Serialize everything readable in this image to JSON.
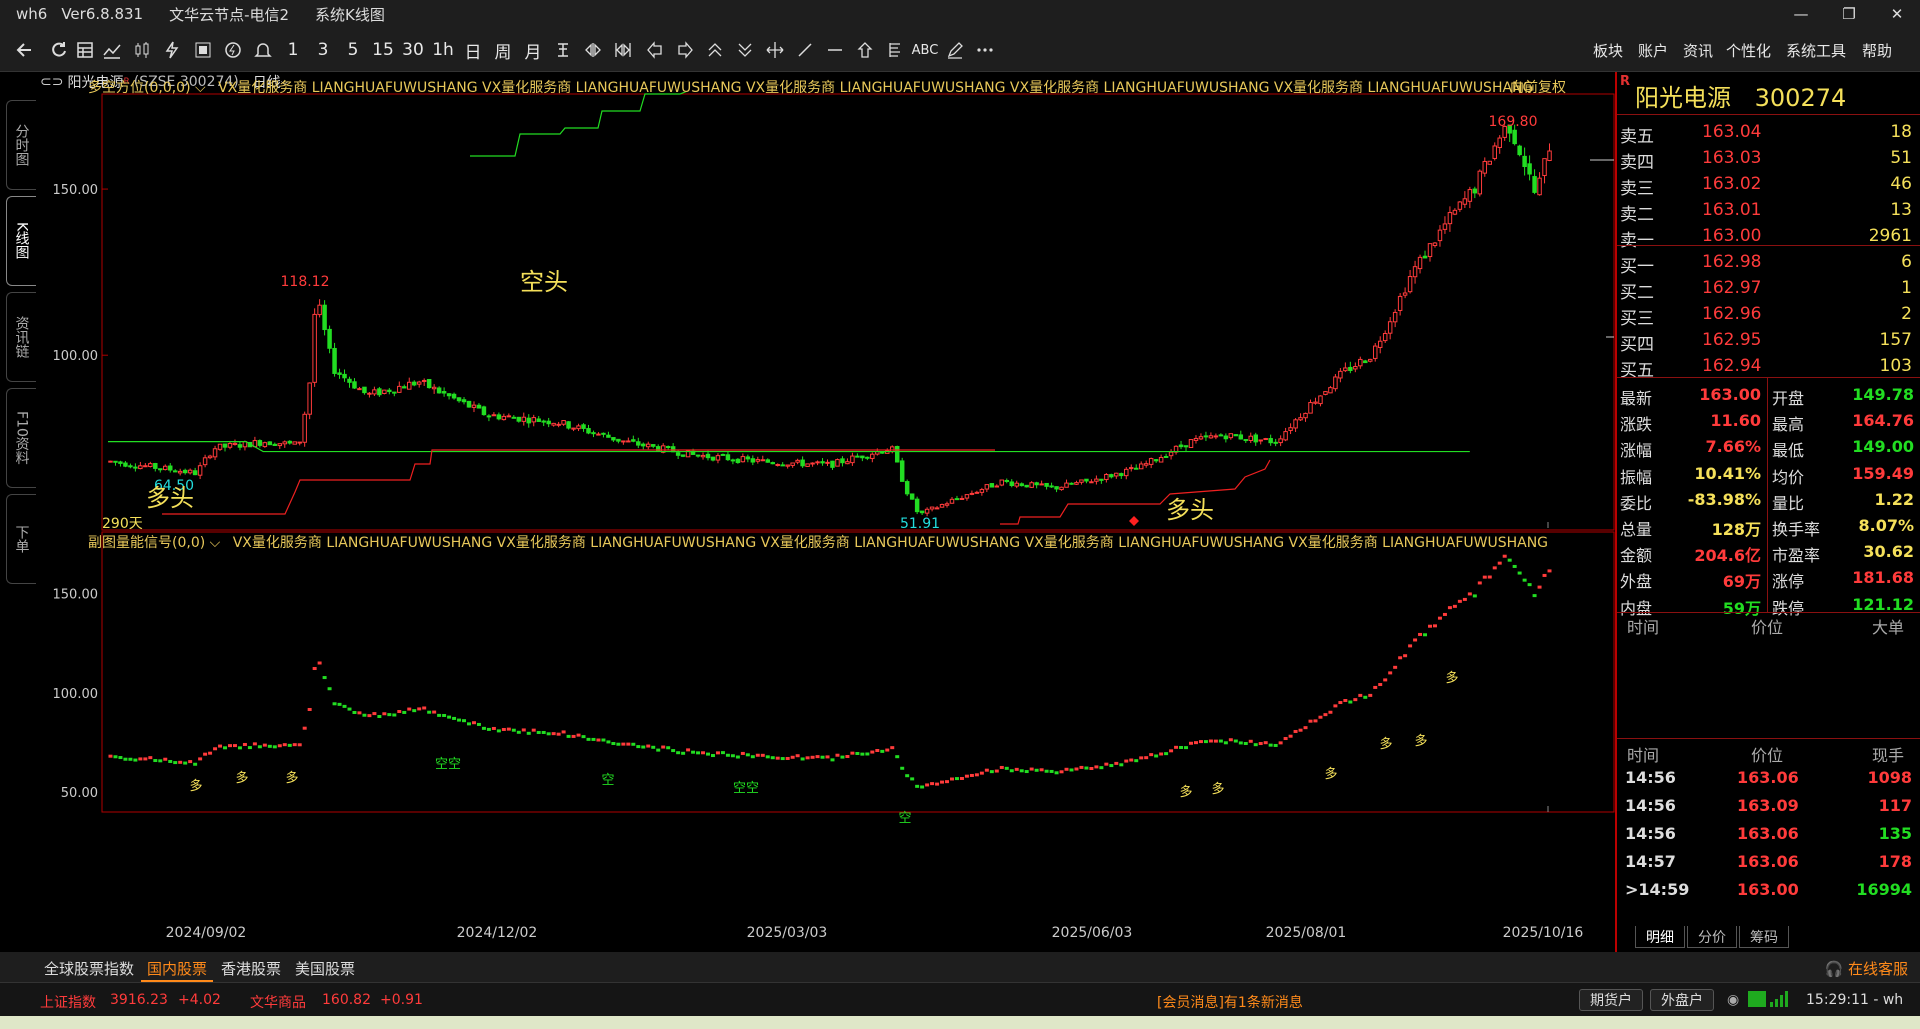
{
  "window": {
    "app": "wh6",
    "version": "Ver6.8.831",
    "server": "文华云节点-电信2",
    "view": "系统K线图",
    "controls": [
      "—",
      "❐",
      "✕"
    ]
  },
  "toolbar": {
    "period_buttons": [
      "1",
      "3",
      "5",
      "15",
      "30",
      "1h",
      "日",
      "周",
      "月"
    ],
    "menus": [
      "板块",
      "账户",
      "资讯",
      "个性化",
      "系统工具",
      "帮助"
    ],
    "text_tools": [
      "ABC"
    ]
  },
  "left_tabs": [
    {
      "label": "分时图"
    },
    {
      "label": "K线图"
    },
    {
      "label": "资讯链"
    },
    {
      "label": "F10资料"
    },
    {
      "label": "下单"
    }
  ],
  "stock_title": {
    "name": "阳光电源",
    "sup": "R",
    "code": "(SZSE 300274)",
    "period": "日线"
  },
  "main_panel": {
    "indicator_name": "多空方位(0,0,0)",
    "indicator_text": "VX量化服务商  LIANGHUAFUWUSHANG  VX量化服务商  LIANGHUAFUWUSHANG  VX量化服务商  LIANGHUAFUWUSHANG  VX量化服务商  LIANGHUAFUWUSHANG  VX量化服务商  LIANGHUAFUWUSHANG",
    "adjust_label": "向前复权",
    "days_label": "290天",
    "annotations": {
      "kong_tou": "空头",
      "duo_tou_1": "多头",
      "duo_tou_2": "多头",
      "high_label": "169.80",
      "local_high_label": "118.12",
      "low_label": "64.50",
      "min_label": "51.91"
    }
  },
  "sub_panel": {
    "indicator_name": "副图量能信号(0,0)",
    "indicator_text": "VX量化服务商  LIANGHUAFUWUSHANG  VX量化服务商  LIANGHUAFUWUSHANG  VX量化服务商  LIANGHUAFUWUSHANG  VX量化服务商  LIANGHUAFUWUSHANG  VX量化服务商  LIANGHUAFUWUSHANG",
    "marks": [
      "多",
      "多",
      "多",
      "空空",
      "空",
      "空空",
      "空",
      "多",
      "多",
      "多",
      "多",
      "多",
      "多"
    ]
  },
  "chart_data": {
    "type": "candlestick",
    "main_y_ticks": [
      "150.00",
      "100.00"
    ],
    "sub_y_ticks": [
      "150.00",
      "100.00",
      "50.00"
    ],
    "x_ticks": [
      "2024/09/02",
      "2024/12/02",
      "2025/03/03",
      "2025/06/03",
      "2025/08/01",
      "2025/10/16"
    ],
    "main_ylim": [
      48,
      175
    ],
    "sub_ylim": [
      40,
      175
    ],
    "n_bars": 290,
    "price_path_anchors": [
      [
        0,
        68
      ],
      [
        15,
        66
      ],
      [
        25,
        64.5
      ],
      [
        30,
        72
      ],
      [
        45,
        74
      ],
      [
        55,
        73
      ],
      [
        58,
        90
      ],
      [
        60,
        118.12
      ],
      [
        65,
        96
      ],
      [
        75,
        88
      ],
      [
        90,
        92
      ],
      [
        110,
        82
      ],
      [
        130,
        80
      ],
      [
        150,
        74
      ],
      [
        170,
        70
      ],
      [
        190,
        68
      ],
      [
        210,
        67
      ],
      [
        220,
        70
      ],
      [
        228,
        72
      ],
      [
        232,
        60
      ],
      [
        236,
        51.91
      ],
      [
        245,
        56
      ],
      [
        260,
        62
      ],
      [
        275,
        60
      ],
      [
        285,
        62
      ],
      [
        300,
        66
      ],
      [
        315,
        74
      ],
      [
        325,
        76
      ],
      [
        340,
        74
      ],
      [
        350,
        85
      ],
      [
        360,
        95
      ],
      [
        368,
        100
      ],
      [
        373,
        110
      ],
      [
        380,
        125
      ],
      [
        390,
        140
      ],
      [
        398,
        150
      ],
      [
        405,
        165
      ],
      [
        408,
        169.8
      ],
      [
        412,
        160
      ],
      [
        416,
        148
      ],
      [
        420,
        163
      ]
    ],
    "bars_per_anchor_unit": 0.69,
    "resistance_line": [
      [
        0,
        74
      ],
      [
        40,
        74
      ],
      [
        45,
        71
      ],
      [
        395,
        71
      ]
    ],
    "kong_line_points": [
      [
        470,
        142
      ],
      [
        515,
        142
      ],
      [
        520,
        120
      ],
      [
        560,
        120
      ],
      [
        565,
        114
      ],
      [
        598,
        114
      ],
      [
        602,
        97
      ],
      [
        640,
        97
      ],
      [
        645,
        80
      ],
      [
        680,
        80
      ],
      [
        690,
        76
      ],
      [
        812,
        76
      ],
      [
        818,
        70
      ],
      [
        995,
        70
      ]
    ],
    "duo_line_points": [
      [
        162,
        500
      ],
      [
        285,
        500
      ],
      [
        295,
        478
      ],
      [
        300,
        466
      ],
      [
        410,
        466
      ],
      [
        415,
        450
      ],
      [
        430,
        450
      ],
      [
        432,
        436
      ],
      [
        470,
        436
      ],
      [
        995,
        436
      ]
    ],
    "duo_line_points_2": [
      [
        1000,
        510
      ],
      [
        1018,
        510
      ],
      [
        1020,
        503
      ],
      [
        1060,
        503
      ],
      [
        1068,
        490
      ],
      [
        1160,
        490
      ],
      [
        1170,
        480
      ],
      [
        1235,
        475
      ],
      [
        1245,
        463
      ],
      [
        1265,
        455
      ],
      [
        1270,
        446
      ]
    ]
  },
  "quote": {
    "flag": "R",
    "name": "阳光电源",
    "code": "300274",
    "asks": [
      {
        "label": "卖五",
        "price": "163.04",
        "vol": "18"
      },
      {
        "label": "卖四",
        "price": "163.03",
        "vol": "51"
      },
      {
        "label": "卖三",
        "price": "163.02",
        "vol": "46"
      },
      {
        "label": "卖二",
        "price": "163.01",
        "vol": "13"
      },
      {
        "label": "卖一",
        "price": "163.00",
        "vol": "2961"
      }
    ],
    "bids": [
      {
        "label": "买一",
        "price": "162.98",
        "vol": "6"
      },
      {
        "label": "买二",
        "price": "162.97",
        "vol": "1"
      },
      {
        "label": "买三",
        "price": "162.96",
        "vol": "2"
      },
      {
        "label": "买四",
        "price": "162.95",
        "vol": "157"
      },
      {
        "label": "买五",
        "price": "162.94",
        "vol": "103"
      }
    ],
    "stats": [
      {
        "l": "最新",
        "v": "163.00",
        "c": "#ff3b3b",
        "l2": "开盘",
        "v2": "149.78",
        "c2": "#22dd22"
      },
      {
        "l": "涨跌",
        "v": "11.60",
        "c": "#ff3b3b",
        "l2": "最高",
        "v2": "164.76",
        "c2": "#ff3b3b"
      },
      {
        "l": "涨幅",
        "v": "7.66%",
        "c": "#ff3b3b",
        "l2": "最低",
        "v2": "149.00",
        "c2": "#22dd22"
      },
      {
        "l": "振幅",
        "v": "10.41%",
        "c": "#f5e05a",
        "l2": "均价",
        "v2": "159.49",
        "c2": "#ff3b3b"
      },
      {
        "l": "委比",
        "v": "-83.98%",
        "c": "#f5e05a",
        "l2": "量比",
        "v2": "1.22",
        "c2": "#f5e05a"
      },
      {
        "l": "总量",
        "v": "128万",
        "c": "#f5e05a",
        "l2": "换手率",
        "v2": "8.07%",
        "c2": "#f5e05a"
      },
      {
        "l": "金额",
        "v": "204.6亿",
        "c": "#ff3b3b",
        "l2": "市盈率",
        "v2": "30.62",
        "c2": "#f5e05a"
      },
      {
        "l": "外盘",
        "v": "69万",
        "c": "#ff3b3b",
        "l2": "涨停",
        "v2": "181.68",
        "c2": "#ff3b3b"
      },
      {
        "l": "内盘",
        "v": "59万",
        "c": "#22dd22",
        "l2": "跌停",
        "v2": "121.12",
        "c2": "#22dd22"
      }
    ],
    "bigorder_head": [
      "时间",
      "价位",
      "大单"
    ],
    "ticks_head": [
      "时间",
      "价位",
      "现手"
    ],
    "ticks": [
      {
        "time": "14:56",
        "price": "163.06",
        "vol": "1098",
        "vc": "#ff3b3b"
      },
      {
        "time": "14:56",
        "price": "163.09",
        "vol": "117",
        "vc": "#ff3b3b"
      },
      {
        "time": "14:56",
        "price": "163.06",
        "vol": "135",
        "vc": "#22dd22"
      },
      {
        "time": "14:57",
        "price": "163.06",
        "vol": "178",
        "vc": "#ff3b3b"
      },
      {
        "time": ">14:59",
        "price": "163.00",
        "vol": "16994",
        "vc": "#22dd22"
      }
    ],
    "tabs": [
      "明细",
      "分价",
      "筹码"
    ]
  },
  "market_tabs": [
    "全球股票指数",
    "国内股票",
    "香港股票",
    "美国股票"
  ],
  "market_active": 1,
  "service_label": "在线客服",
  "status": {
    "idx1_name": "上证指数",
    "idx1_val": "3916.23",
    "idx1_chg": "+4.02",
    "idx2_name": "文华商品",
    "idx2_val": "160.82",
    "idx2_chg": "+0.91",
    "msg": "[会员消息]有1条新消息",
    "btn1": "期货户",
    "btn2": "外盘户",
    "clock": "15:29:11 - wh"
  },
  "colors": {
    "up": "#ff3b3b",
    "down": "#22dd22",
    "label_yellow": "#f5e05a",
    "border_red": "#b00000",
    "orange": "#ff8a1a"
  }
}
